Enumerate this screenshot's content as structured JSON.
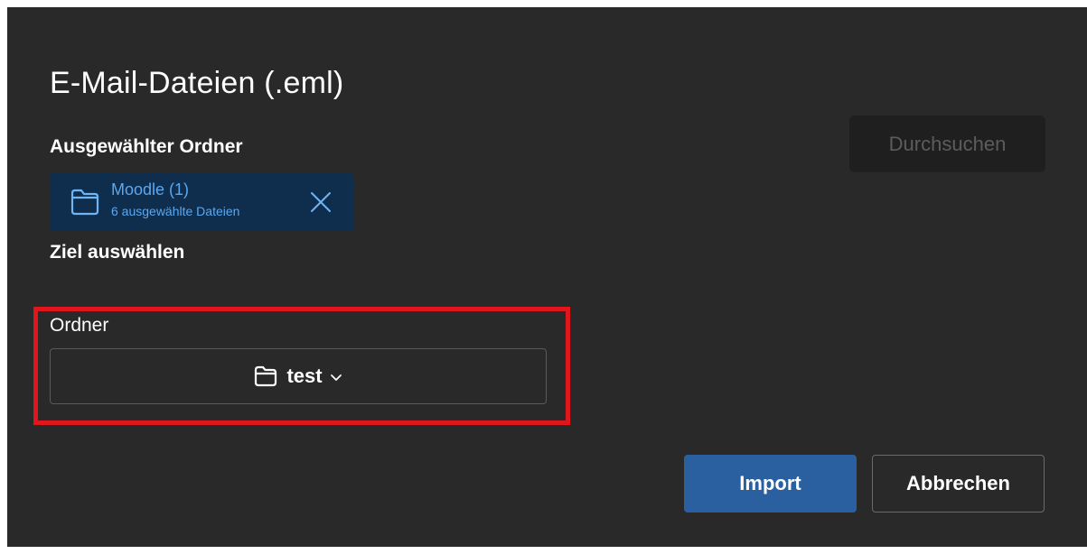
{
  "dialog": {
    "title": "E-Mail-Dateien (.eml)",
    "browse_label": "Durchsuchen",
    "selected_folder_heading": "Ausgewählter Ordner",
    "selected_folder": {
      "name": "Moodle (1)",
      "subtitle": "6 ausgewählte Dateien",
      "icon": "folder-icon",
      "remove_icon": "close-icon"
    },
    "target_heading": "Ziel auswählen",
    "folder_field": {
      "label": "Ordner",
      "value": "test",
      "icon": "folder-icon",
      "chevron": "chevron-down-icon"
    },
    "import_label": "Import",
    "cancel_label": "Abbrechen"
  },
  "colors": {
    "dialog_background": "#292929",
    "primary_button": "#2a5fa0",
    "chip_background": "#0f2d4d",
    "chip_text": "#5aa8f0",
    "highlight_border": "#e0161c"
  }
}
